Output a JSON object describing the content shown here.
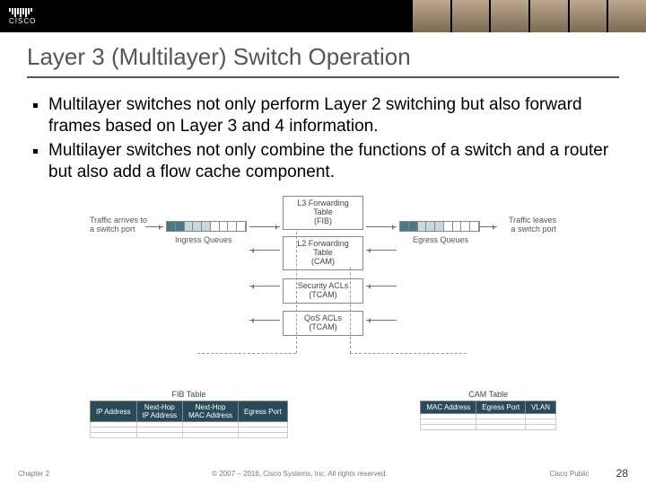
{
  "logo_text": "CISCO",
  "title": "Layer 3 (Multilayer) Switch Operation",
  "bullets": [
    "Multilayer switches not only perform Layer 2 switching but also forward frames based on Layer 3 and 4 information.",
    "Multilayer switches not only combine the functions of a switch and a router but also add a flow cache component."
  ],
  "diagram": {
    "traffic_in": "Traffic arrives to\na switch port",
    "traffic_out": "Traffic leaves\na switch port",
    "ingress_label": "Ingress Queues",
    "egress_label": "Egress Queues",
    "pipeline": [
      "L3 Forwarding\nTable\n(FIB)",
      "L2 Forwarding\nTable\n(CAM)",
      "Security ACLs\n(TCAM)",
      "QoS ACLs\n(TCAM)"
    ],
    "fib_table": {
      "title": "FIB Table",
      "headers": [
        "IP Address",
        "Next-Hop\nIP Address",
        "Next-Hop\nMAC Address",
        "Egress Port"
      ]
    },
    "cam_table": {
      "title": "CAM Table",
      "headers": [
        "MAC Address",
        "Egress Port",
        "VLAN"
      ]
    }
  },
  "footer": {
    "left": "Chapter 2",
    "center": "© 2007 – 2016, Cisco Systems, Inc. All rights reserved.",
    "right": "Cisco Public",
    "page": "28"
  }
}
